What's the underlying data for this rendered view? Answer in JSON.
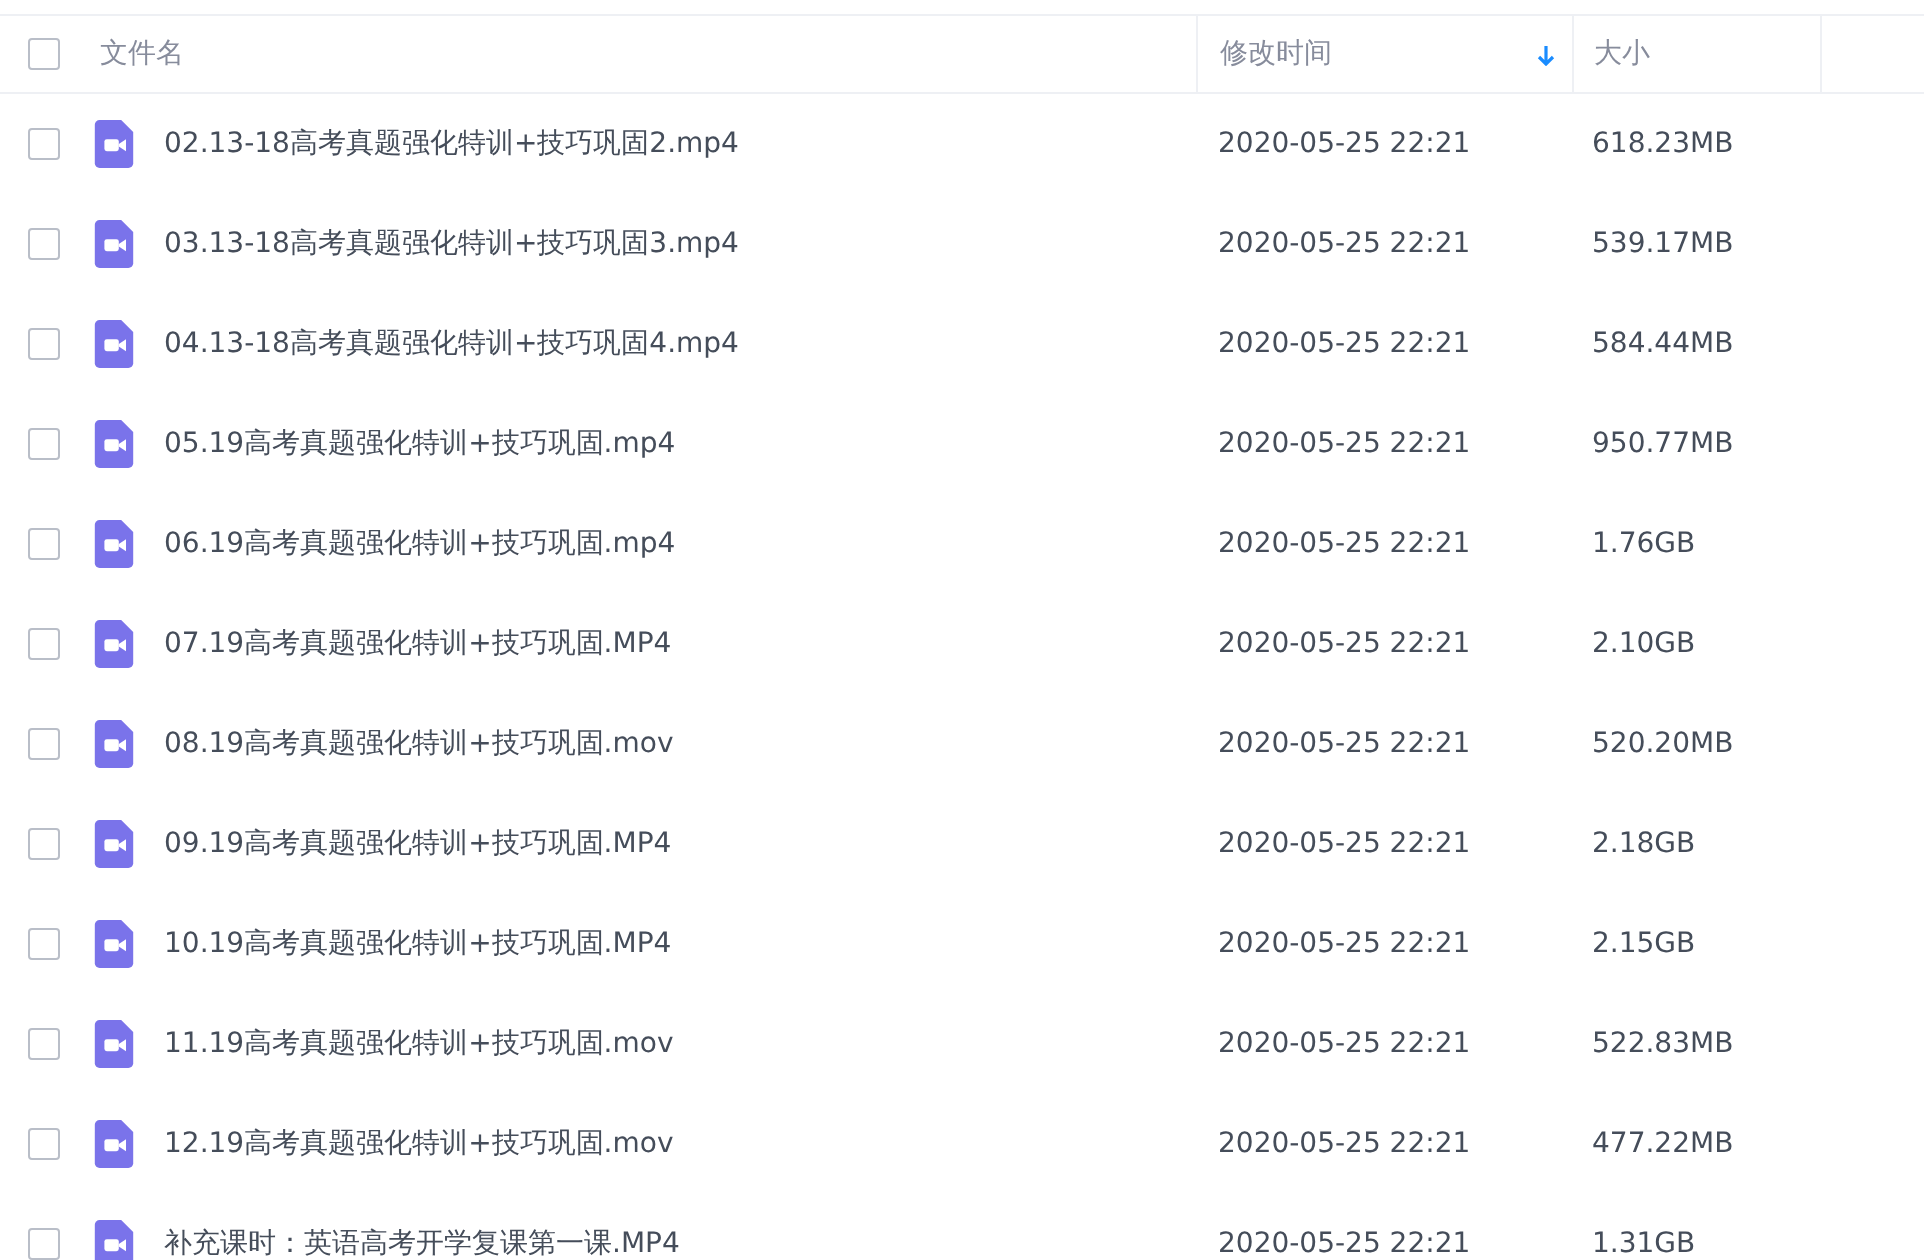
{
  "table": {
    "select_all": {
      "checked": false
    },
    "columns": [
      {
        "label": "文件名",
        "sorted": false
      },
      {
        "label": "修改时间",
        "sorted": true
      },
      {
        "label": "大小",
        "sorted": false
      }
    ],
    "rows": [
      {
        "checked": false,
        "kind": "video",
        "name": "02.13-18高考真题强化特训+技巧巩固2.mp4",
        "modified": "2020-05-25 22:21",
        "size": "618.23MB"
      },
      {
        "checked": false,
        "kind": "video",
        "name": "03.13-18高考真题强化特训+技巧巩固3.mp4",
        "modified": "2020-05-25 22:21",
        "size": "539.17MB"
      },
      {
        "checked": false,
        "kind": "video",
        "name": "04.13-18高考真题强化特训+技巧巩固4.mp4",
        "modified": "2020-05-25 22:21",
        "size": "584.44MB"
      },
      {
        "checked": false,
        "kind": "video",
        "name": "05.19高考真题强化特训+技巧巩固.mp4",
        "modified": "2020-05-25 22:21",
        "size": "950.77MB"
      },
      {
        "checked": false,
        "kind": "video",
        "name": "06.19高考真题强化特训+技巧巩固.mp4",
        "modified": "2020-05-25 22:21",
        "size": "1.76GB"
      },
      {
        "checked": false,
        "kind": "video",
        "name": "07.19高考真题强化特训+技巧巩固.MP4",
        "modified": "2020-05-25 22:21",
        "size": "2.10GB"
      },
      {
        "checked": false,
        "kind": "video",
        "name": "08.19高考真题强化特训+技巧巩固.mov",
        "modified": "2020-05-25 22:21",
        "size": "520.20MB"
      },
      {
        "checked": false,
        "kind": "video",
        "name": "09.19高考真题强化特训+技巧巩固.MP4",
        "modified": "2020-05-25 22:21",
        "size": "2.18GB"
      },
      {
        "checked": false,
        "kind": "video",
        "name": "10.19高考真题强化特训+技巧巩固.MP4",
        "modified": "2020-05-25 22:21",
        "size": "2.15GB"
      },
      {
        "checked": false,
        "kind": "video",
        "name": "11.19高考真题强化特训+技巧巩固.mov",
        "modified": "2020-05-25 22:21",
        "size": "522.83MB"
      },
      {
        "checked": false,
        "kind": "video",
        "name": "12.19高考真题强化特训+技巧巩固.mov",
        "modified": "2020-05-25 22:21",
        "size": "477.22MB"
      },
      {
        "checked": false,
        "kind": "video",
        "name": "补充课时：英语高考开学复课第一课.MP4",
        "modified": "2020-05-25 22:21",
        "size": "1.31GB"
      }
    ]
  }
}
